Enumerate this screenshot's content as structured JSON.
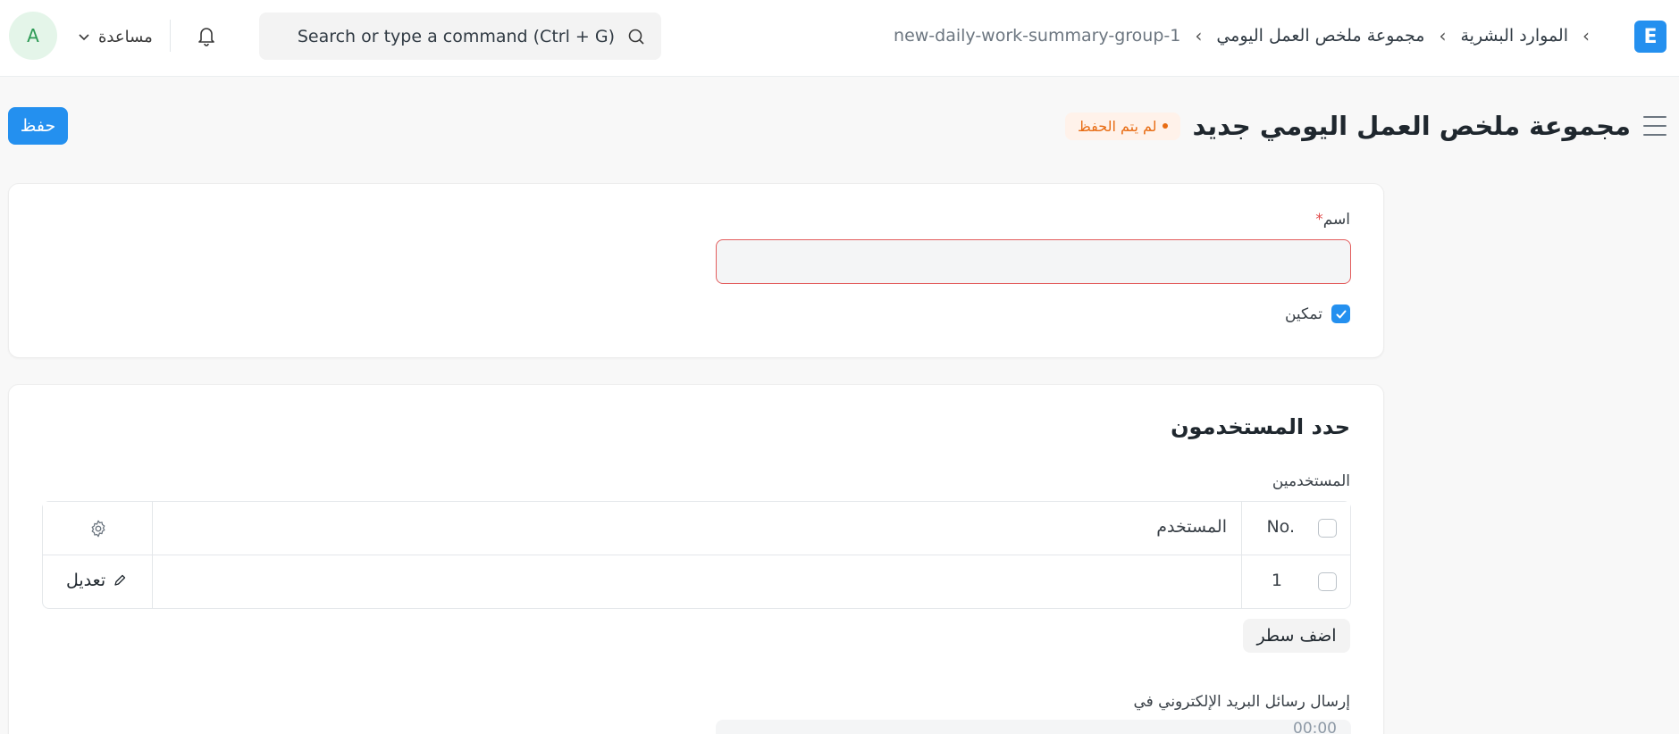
{
  "navbar": {
    "avatar_initial": "A",
    "help_label": "مساعدة",
    "search_placeholder": "Search or type a command (Ctrl + G)",
    "breadcrumb": [
      "الموارد البشرية",
      "مجموعة ملخص العمل اليومي",
      "new-daily-work-summary-group-1"
    ],
    "breadcrumb_separator": "›",
    "logo_letter": "E"
  },
  "page_head": {
    "title": "مجموعة ملخص العمل اليومي جديد",
    "status_badge": "لم يتم الحفظ",
    "save_label": "حفظ"
  },
  "form": {
    "name_label": "اسم",
    "required_mark": "*",
    "name_value": "",
    "enable_label": "تمكين",
    "enable_checked": true
  },
  "users_section": {
    "title": "حدد المستخدمون",
    "users_label": "المستخدمين",
    "columns": {
      "no": "No.",
      "user": "المستخدم"
    },
    "rows": [
      {
        "no": "1",
        "user": "",
        "edit_label": "تعديل"
      }
    ],
    "add_row_label": "اضف سطر",
    "send_emails_label": "إرسال رسائل البريد الإلكتروني في",
    "send_emails_value": "00:00"
  },
  "colors": {
    "primary": "#2490ef",
    "warning": "#e86c13",
    "error_border": "#e35d5d"
  },
  "icons": [
    "chevron-down-icon",
    "bell-icon",
    "search-icon",
    "hamburger-icon",
    "check-icon",
    "gear-icon",
    "pencil-icon"
  ]
}
